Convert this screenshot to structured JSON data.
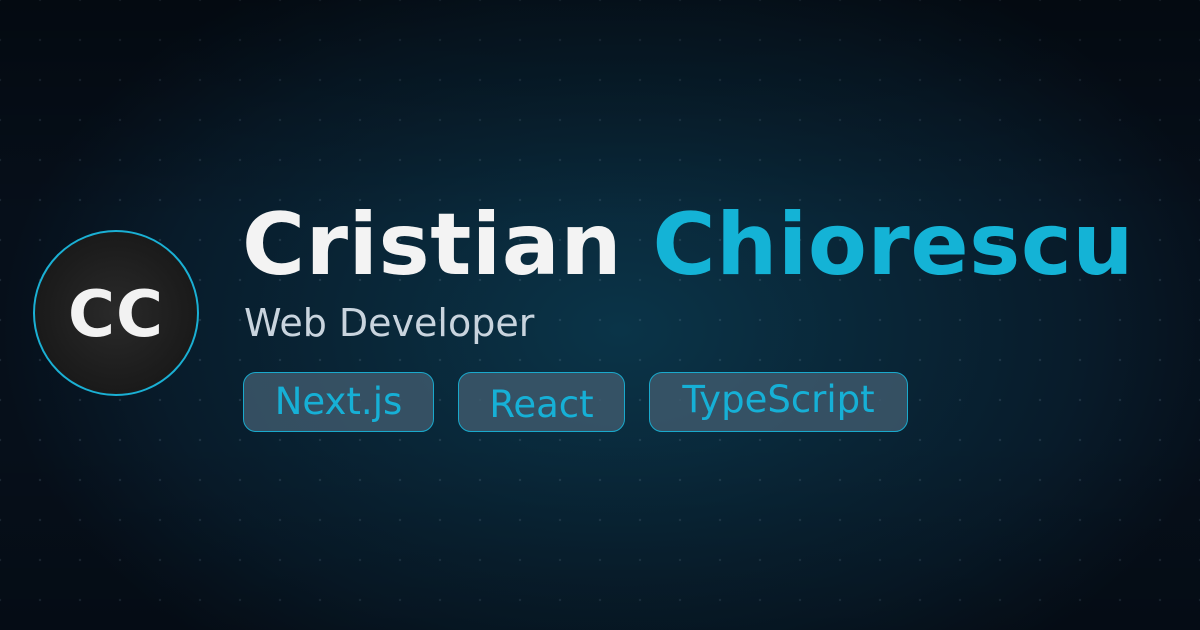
{
  "colors": {
    "background": "#081b2a",
    "accent": "#14b3d6",
    "name_first": "#f3f3f3",
    "role_text": "#c9d4de",
    "avatar_fill": "#1c1c1c",
    "tag_fill": "#415c70"
  },
  "avatar": {
    "initials": "CC"
  },
  "profile": {
    "first_name": "Cristian",
    "last_name": "Chiorescu",
    "role": "Web Developer"
  },
  "tags": [
    "Next.js",
    "React",
    "TypeScript"
  ]
}
